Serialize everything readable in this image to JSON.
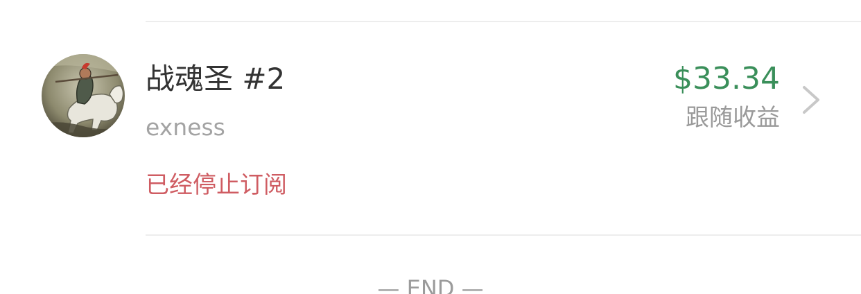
{
  "item": {
    "avatar_icon": "warrior-on-horse-avatar",
    "name": "战魂圣 #2",
    "broker": "exness",
    "status": "已经停止订阅",
    "profit": "$33.34",
    "profit_label": "跟随收益",
    "arrow_icon": "chevron-right-icon"
  },
  "footer": {
    "end_text": "— END —"
  },
  "colors": {
    "profit": "#3a8f5a",
    "status": "#cf5c62",
    "name": "#333333",
    "secondary": "#a3a3a3"
  }
}
